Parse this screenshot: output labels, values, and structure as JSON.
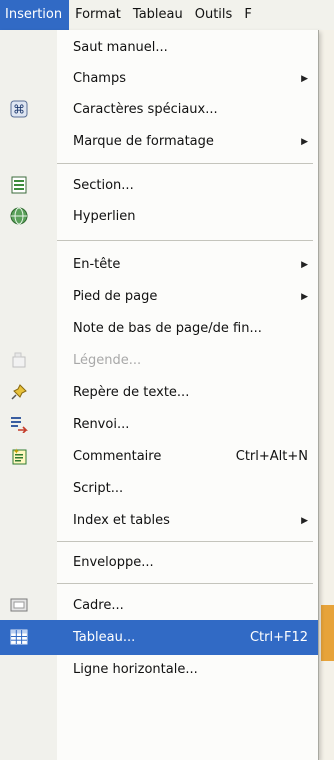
{
  "menubar": {
    "items": [
      {
        "label": "Insertion",
        "active": true
      },
      {
        "label": "Format"
      },
      {
        "label": "Tableau"
      },
      {
        "label": "Outils"
      },
      {
        "label": "F"
      }
    ]
  },
  "menu": {
    "items": [
      {
        "label": "Saut manuel..."
      },
      {
        "label": "Champs",
        "submenu": true
      },
      {
        "label": "Caractères spéciaux...",
        "icon": "special-characters-icon"
      },
      {
        "label": "Marque de formatage",
        "submenu": true
      },
      {
        "label": "Section...",
        "icon": "section-icon"
      },
      {
        "label": "Hyperlien",
        "icon": "hyperlink-icon"
      },
      {
        "label": "En-tête",
        "submenu": true
      },
      {
        "label": "Pied de page",
        "submenu": true
      },
      {
        "label": "Note de bas de page/de fin..."
      },
      {
        "label": "Légende...",
        "icon": "caption-icon",
        "disabled": true
      },
      {
        "label": "Repère de texte...",
        "icon": "bookmark-icon"
      },
      {
        "label": "Renvoi...",
        "icon": "cross-reference-icon"
      },
      {
        "label": "Commentaire",
        "icon": "comment-icon",
        "shortcut": "Ctrl+Alt+N"
      },
      {
        "label": "Script..."
      },
      {
        "label": "Index et tables",
        "submenu": true
      },
      {
        "label": "Enveloppe..."
      },
      {
        "label": "Cadre...",
        "icon": "frame-icon"
      },
      {
        "label": "Tableau...",
        "icon": "table-icon",
        "shortcut": "Ctrl+F12",
        "selected": true
      },
      {
        "label": "Ligne horizontale..."
      }
    ]
  },
  "colors": {
    "selection": "#316ac5",
    "menu_background": "#fcfcfa",
    "gutter": "#f1f1ec"
  }
}
